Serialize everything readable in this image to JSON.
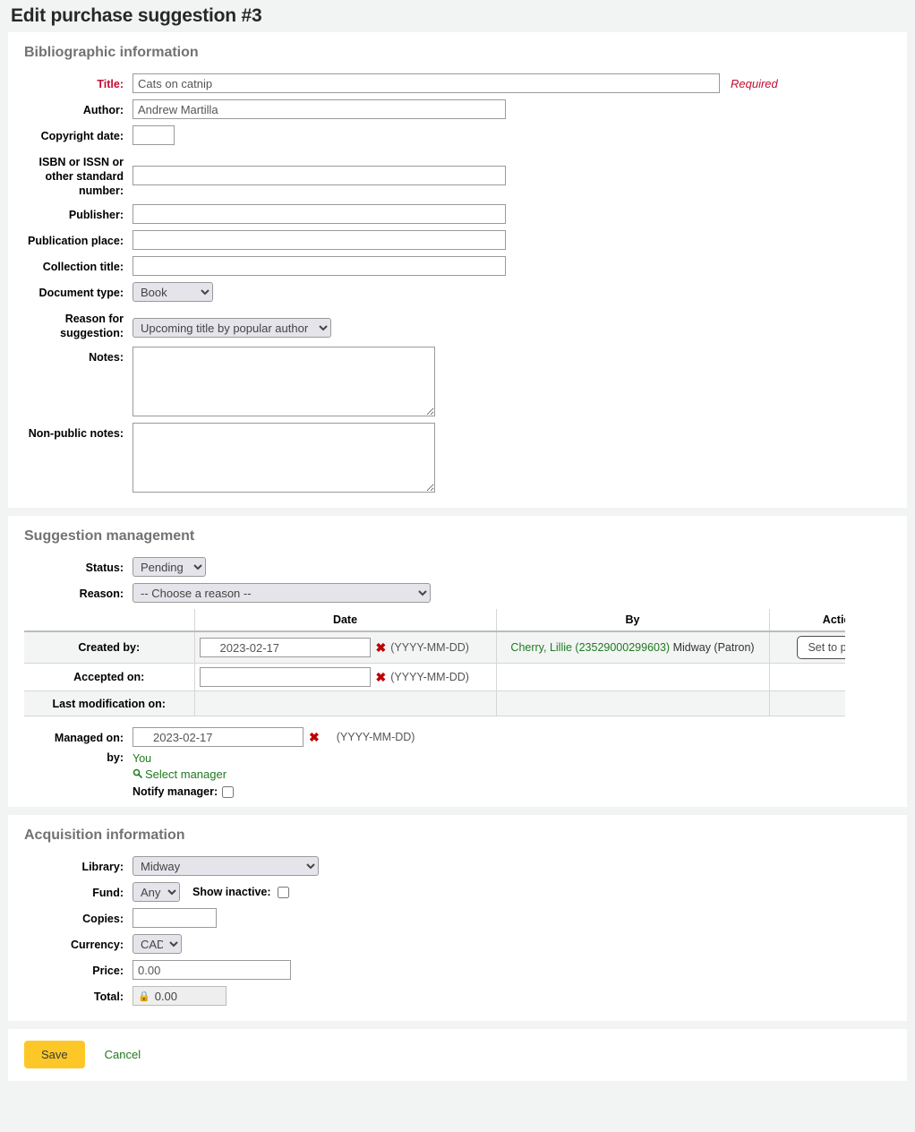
{
  "page": {
    "title": "Edit purchase suggestion #3",
    "accent_amber": "#fdc727",
    "link_green": "#1f7a1f",
    "required_red": "#c60c30"
  },
  "bibliographic": {
    "heading": "Bibliographic information",
    "title_label": "Title:",
    "title_value": "Cats on catnip",
    "title_required_note": "Required",
    "author_label": "Author:",
    "author_value": "Andrew Martilla",
    "copyright_label": "Copyright date:",
    "copyright_value": "",
    "isbn_label": "ISBN or ISSN or other standard number:",
    "isbn_value": "",
    "publisher_label": "Publisher:",
    "publisher_value": "",
    "pubplace_label": "Publication place:",
    "pubplace_value": "",
    "collection_label": "Collection title:",
    "collection_value": "",
    "doctype_label": "Document type:",
    "doctype_value": "Book",
    "reason_label": "Reason for suggestion:",
    "reason_value": "Upcoming title by popular author",
    "notes_label": "Notes:",
    "notes_value": "",
    "nonpublic_label": "Non-public notes:",
    "nonpublic_value": ""
  },
  "management": {
    "heading": "Suggestion management",
    "status_label": "Status:",
    "status_value": "Pending",
    "reason_label": "Reason:",
    "reason_value": "-- Choose a reason --",
    "table": {
      "headers": [
        "",
        "Date",
        "By",
        "Action"
      ],
      "rows": [
        {
          "label": "Created by:",
          "date": "2023-02-17",
          "date_hint": "(YYYY-MM-DD)",
          "by_link": "Cherry, Lillie (23529000299603)",
          "by_text": "Midway (Patron)",
          "action": "Set to patron"
        },
        {
          "label": "Accepted on:",
          "date": "",
          "date_hint": "(YYYY-MM-DD)",
          "by_link": "",
          "by_text": "",
          "action": ""
        },
        {
          "label": "Last modification on:",
          "date": "",
          "date_hint": "",
          "by_link": "",
          "by_text": "",
          "action": ""
        }
      ]
    },
    "managed_on_label": "Managed on:",
    "managed_on_value": "2023-02-17",
    "managed_on_hint": "(YYYY-MM-DD)",
    "by_label": "by:",
    "by_value": "You",
    "select_manager": "Select manager",
    "notify_label": "Notify manager:",
    "notify_checked": false
  },
  "acquisition": {
    "heading": "Acquisition information",
    "library_label": "Library:",
    "library_value": "Midway",
    "fund_label": "Fund:",
    "fund_value": "Any",
    "show_inactive_label": "Show inactive:",
    "show_inactive_checked": false,
    "copies_label": "Copies:",
    "copies_value": "",
    "currency_label": "Currency:",
    "currency_value": "CAD",
    "price_label": "Price:",
    "price_value": "0.00",
    "total_label": "Total:",
    "total_value": "0.00"
  },
  "footer": {
    "save_label": "Save",
    "cancel_label": "Cancel"
  }
}
